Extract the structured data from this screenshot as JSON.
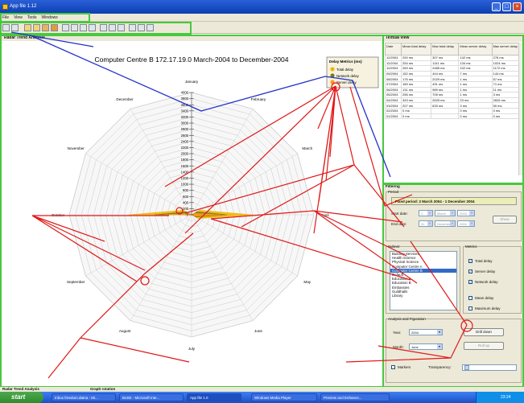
{
  "window": {
    "title": "App file 1.12"
  },
  "menu": [
    "File",
    "View",
    "Tools",
    "Windows"
  ],
  "toolbar": {
    "icons": [
      "save-icon",
      "print-icon",
      "chart-icon",
      "radar-icon",
      "table-icon",
      "folder-icon",
      "zoom-icon",
      "search-icon",
      "link-icon",
      "refresh-icon",
      "grid-icon",
      "export-icon",
      "settings-icon",
      "layout-icon",
      "window-icon",
      "help-icon"
    ]
  },
  "chart_pane": {
    "header": "Radar Trend Analysis"
  },
  "chart_data": {
    "type": "radar",
    "title": "Computer Centre B  172.17.19.0  March-2004 to December-2004",
    "axes": [
      "January",
      "February",
      "March",
      "April",
      "May",
      "June",
      "July",
      "August",
      "September",
      "October",
      "November",
      "December"
    ],
    "radial_ticks": [
      4000,
      3800,
      3600,
      3400,
      3200,
      3000,
      2800,
      2600,
      2400,
      2200,
      2000,
      1800,
      1600,
      1400,
      1200,
      1000,
      800,
      600,
      400,
      200,
      0
    ],
    "rmax": 4000,
    "legend": {
      "title": "Delay Metrics (ms)",
      "position": "top-right"
    },
    "series": [
      {
        "name": "Total delay",
        "color": "#f2b400",
        "values": [
          0,
          0,
          300,
          2000,
          250,
          0,
          0,
          0,
          0,
          2050,
          300,
          0
        ]
      },
      {
        "name": "Network delay",
        "color": "#7a7b1a",
        "values": [
          0,
          0,
          200,
          1150,
          150,
          0,
          0,
          0,
          0,
          1200,
          200,
          0
        ]
      },
      {
        "name": "Server delay",
        "color": "#ff9a1e",
        "values": [
          0,
          0,
          100,
          950,
          100,
          0,
          0,
          0,
          0,
          900,
          100,
          0
        ]
      }
    ]
  },
  "text_view": {
    "header": "Textual view",
    "columns": [
      "Date",
      "Mean total delay",
      "Max total delay",
      "Mean server delay",
      "Max server delay"
    ],
    "rows": [
      [
        "12/2004",
        "200 ms",
        "307 ms",
        "142 ms",
        "276 ms"
      ],
      [
        "11/2004",
        "254 ms",
        "1141 ms",
        "134 ms",
        "1024 ms"
      ],
      [
        "10/2004",
        "269 ms",
        "2485 ms",
        "102 ms",
        "1172 ms"
      ],
      [
        "09/2004",
        "152 ms",
        "444 ms",
        "7 ms",
        "144 ms"
      ],
      [
        "08/2004",
        "176 ms",
        "2029 ms",
        "1 ms",
        "67 ms"
      ],
      [
        "07/2004",
        "189 ms",
        "491 ms",
        "1 ms",
        "71 ms"
      ],
      [
        "06/2004",
        "131 ms",
        "989 ms",
        "1 ms",
        "11 ms"
      ],
      [
        "05/2004",
        "256 ms",
        "705 ms",
        "1 ms",
        "3 ms"
      ],
      [
        "04/2004",
        "343 ms",
        "2625 ms",
        "23 ms",
        "2626 ms"
      ],
      [
        "03/2004",
        "207 ms",
        "633 ms",
        "3 ms",
        "50 ms"
      ],
      [
        "02/2004",
        "0 ms",
        "",
        "0 ms",
        "0 ms"
      ],
      [
        "01/2004",
        "0 ms",
        "",
        "0 ms",
        "0 ms"
      ]
    ]
  },
  "filtering": {
    "header": "Filtering",
    "period_label": "Period",
    "fixed_period": "Fixed period: 2 March 2004 - 1 December 2004",
    "start_date_label": "Start date:",
    "start_day": "1",
    "start_month": "March",
    "start_year": "2004",
    "end_date_label": "End date:",
    "end_day": "31",
    "end_month": "December",
    "end_year": "2004",
    "show_button": "Show",
    "subnet_label": "Subnet",
    "subnets": [
      "Building Services",
      "Health Science",
      "Physical Science",
      "Computer Centre A",
      "Computer Centre B",
      "Default",
      "Education A",
      "Education B",
      "Embassies",
      "Guildhalls",
      "Library"
    ],
    "selected_subnet": 4,
    "metrics_label": "Metrics",
    "metrics": [
      {
        "label": "Total delay",
        "checked": true
      },
      {
        "label": "Server delay",
        "checked": true
      },
      {
        "label": "Network delay",
        "checked": true
      },
      {
        "label": "Mean delay",
        "checked": false
      },
      {
        "label": "Maximum delay",
        "checked": false
      }
    ],
    "config_label": "Analysis and Figuration",
    "year_label": "Year:",
    "year": "2004",
    "month_label": "Month:",
    "month": "June",
    "drill_button": "Drill down",
    "rollup_button": "Roll up",
    "markers_label": "Markers",
    "transparency_label": "Transparency:"
  },
  "status": {
    "left": "Radar Trend Analysis",
    "mid": "Graph rotation"
  },
  "taskbar": {
    "start": "start",
    "tasks": [
      "Inbox freedom.datna - Mi...",
      "BoSE - Microsoft Inte...",
      "App file 1.0",
      "Windows Media Player",
      "Preview and Enhance..."
    ],
    "clock": "23:24"
  },
  "accent": {
    "annotation_red": "#e01818",
    "annotation_blue": "#2332c8",
    "frame_green": "#47c83e"
  }
}
